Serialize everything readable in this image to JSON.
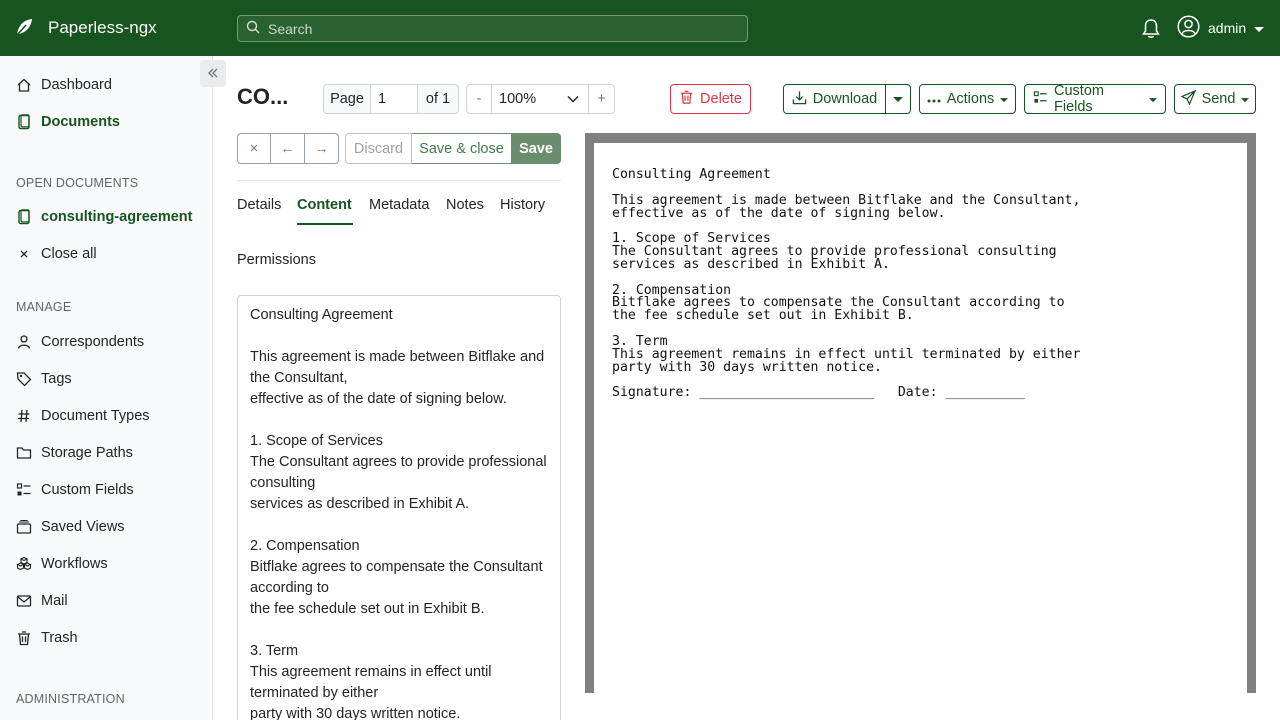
{
  "app": {
    "title": "Paperless-ngx"
  },
  "header": {
    "search_placeholder": "Search",
    "user": "admin"
  },
  "sidebar": {
    "items_main": [
      {
        "label": "Dashboard",
        "icon": "house-icon"
      },
      {
        "label": "Documents",
        "icon": "file-icon",
        "active": true
      }
    ],
    "open_documents_label": "OPEN DOCUMENTS",
    "open_documents": [
      {
        "label": "consulting-agreement",
        "icon": "file-icon"
      },
      {
        "label": "Close all",
        "icon": "close-icon"
      }
    ],
    "manage_label": "MANAGE",
    "manage_items": [
      {
        "label": "Correspondents",
        "icon": "person-icon"
      },
      {
        "label": "Tags",
        "icon": "tag-icon"
      },
      {
        "label": "Document Types",
        "icon": "hash-icon"
      },
      {
        "label": "Storage Paths",
        "icon": "folder-icon"
      },
      {
        "label": "Custom Fields",
        "icon": "ui-checks-icon"
      },
      {
        "label": "Saved Views",
        "icon": "collection-icon"
      },
      {
        "label": "Workflows",
        "icon": "boxes-icon"
      },
      {
        "label": "Mail",
        "icon": "envelope-icon"
      },
      {
        "label": "Trash",
        "icon": "trash-icon"
      }
    ],
    "administration_label": "ADMINISTRATION"
  },
  "document": {
    "title": "co...",
    "page_label": "Page",
    "page_value": "1",
    "page_of": "of 1",
    "zoom_minus": "-",
    "zoom_value": "100%",
    "zoom_plus": "+"
  },
  "toolbar": {
    "delete_label": "Delete",
    "download_label": "Download",
    "actions_label": "Actions",
    "custom_fields_label": "Custom Fields",
    "send_label": "Send"
  },
  "controls": {
    "close": "×",
    "prev": "←",
    "next": "→",
    "discard": "Discard",
    "save_close": "Save & close",
    "save": "Save"
  },
  "tabs": [
    {
      "label": "Details"
    },
    {
      "label": "Content",
      "active": true
    },
    {
      "label": "Metadata"
    },
    {
      "label": "Notes"
    },
    {
      "label": "History"
    },
    {
      "label": "Permissions"
    }
  ],
  "content_lines": [
    "Consulting Agreement",
    "",
    "This agreement is made between Bitflake and",
    "the Consultant,",
    "effective as of the date of signing below.",
    "",
    "1. Scope of Services",
    "The Consultant agrees to provide professional",
    "consulting",
    "services as described in Exhibit A.",
    "",
    "2. Compensation",
    "Bitflake agrees to compensate the Consultant",
    "according to",
    "the fee schedule set out in Exhibit B.",
    "",
    "3. Term",
    "This agreement remains in effect until",
    "terminated by either",
    "party with 30 days written notice."
  ],
  "preview_lines": [
    "Consulting Agreement",
    "",
    "This agreement is made between Bitflake and the Consultant,",
    "effective as of the date of signing below.",
    "",
    "1. Scope of Services",
    "The Consultant agrees to provide professional consulting",
    "services as described in Exhibit A.",
    "",
    "2. Compensation",
    "Bitflake agrees to compensate the Consultant according to",
    "the fee schedule set out in Exhibit B.",
    "",
    "3. Term",
    "This agreement remains in effect until terminated by either",
    "party with 30 days written notice.",
    "",
    "Signature: ______________________   Date: __________"
  ],
  "colors": {
    "brand": "#17541f",
    "danger": "#dc3545",
    "sidebar_bg": "#f8f9fa"
  }
}
